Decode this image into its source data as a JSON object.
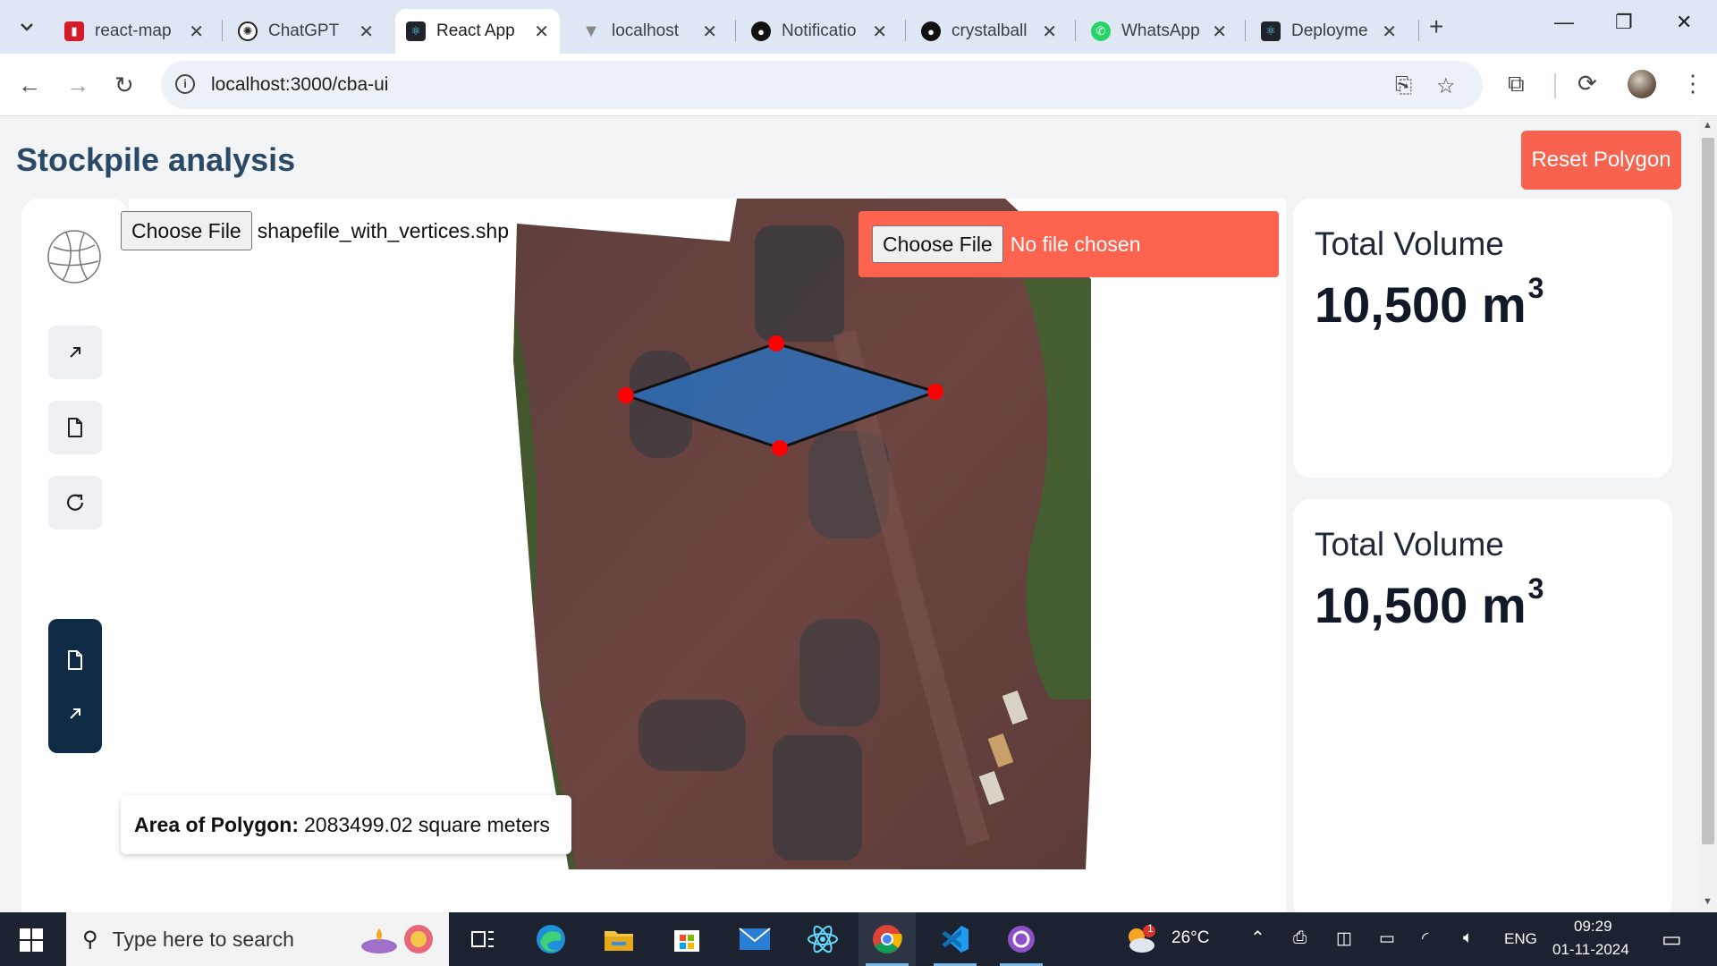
{
  "browser": {
    "tabs": [
      {
        "label": "react-map",
        "icon": "app-icon"
      },
      {
        "label": "ChatGPT",
        "icon": "chatgpt-icon"
      },
      {
        "label": "React App",
        "icon": "react-icon"
      },
      {
        "label": "localhost",
        "icon": "vite-icon"
      },
      {
        "label": "Notificatio",
        "icon": "github-icon"
      },
      {
        "label": "crystalball",
        "icon": "github-icon"
      },
      {
        "label": "WhatsApp",
        "icon": "whatsapp-icon"
      },
      {
        "label": "Deployme",
        "icon": "react-icon"
      }
    ],
    "url": "localhost:3000/cba-ui"
  },
  "app": {
    "title": "Stockpile analysis",
    "reset_label": "Reset Polygon",
    "choose_file_label": "Choose File",
    "shapefile_name": "shapefile_with_vertices.shp",
    "no_file_text": "No file chosen",
    "area_label": "Area of Polygon:",
    "area_value": "2083499.02 square meters",
    "volume_cards": [
      {
        "title": "Total Volume",
        "value": "10,500 m",
        "exp": "3"
      },
      {
        "title": "Total Volume",
        "value": "10,500 m",
        "exp": "3"
      }
    ],
    "sidebar_icons": [
      "globe-icon",
      "arrow-up-right-icon",
      "file-icon",
      "refresh-icon"
    ],
    "sidebar_panel_icons": [
      "file-icon",
      "arrow-up-right-icon"
    ]
  },
  "taskbar": {
    "search_placeholder": "Type here to search",
    "weather_temp": "26°C",
    "weather_badge": "1",
    "language": "ENG",
    "time": "09:29",
    "date": "01-11-2024"
  },
  "colors": {
    "accent": "#f7634f",
    "title": "#2a4966",
    "polygon_fill": "#2f6db5",
    "vertex": "#ff0000",
    "sidebar_panel": "#0f2b46"
  }
}
